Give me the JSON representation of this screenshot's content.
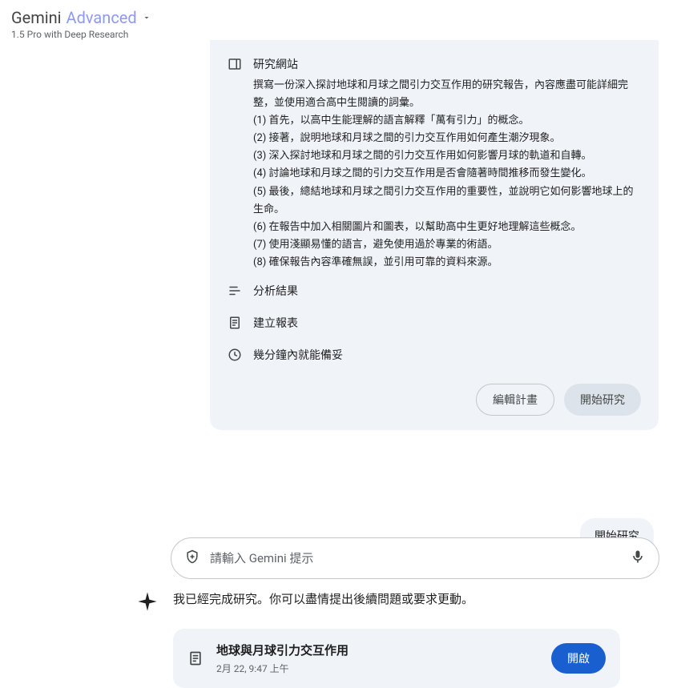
{
  "header": {
    "brand_main": "Gemini",
    "brand_advanced": "Advanced",
    "subtitle": "1.5 Pro with Deep Research"
  },
  "plan": {
    "steps": {
      "research": {
        "title": "研究網站",
        "intro": "撰寫一份深入探討地球和月球之間引力交互作用的研究報告，內容應盡可能詳細完整，並使用適合高中生閱讀的詞彙。",
        "items": [
          "(1) 首先，以高中生能理解的語言解釋「萬有引力」的概念。",
          "(2) 接著，說明地球和月球之間的引力交互作用如何產生潮汐現象。",
          "(3) 深入探討地球和月球之間的引力交互作用如何影響月球的軌道和自轉。",
          "(4) 討論地球和月球之間的引力交互作用是否會隨著時間推移而發生變化。",
          "(5) 最後，總結地球和月球之間引力交互作用的重要性，並說明它如何影響地球上的生命。",
          "(6) 在報告中加入相關圖片和圖表，以幫助高中生更好地理解這些概念。",
          "(7) 使用淺顯易懂的語言，避免使用過於專業的術語。",
          "(8) 確保報告內容準確無誤，並引用可靠的資料來源。"
        ]
      },
      "analyze": {
        "title": "分析結果"
      },
      "report": {
        "title": "建立報表"
      },
      "eta": {
        "title": "幾分鐘內就能備妥"
      }
    },
    "actions": {
      "edit": "編輯計畫",
      "start": "開始研究"
    }
  },
  "user_message": "開始研究",
  "assistant_message": "我已經完成研究。你可以盡情提出後續問題或要求更動。",
  "report_card": {
    "title": "地球與月球引力交互作用",
    "timestamp": "2月 22, 9:47 上午",
    "open_label": "開啟"
  },
  "input": {
    "placeholder": "請輸入 Gemini 提示"
  }
}
